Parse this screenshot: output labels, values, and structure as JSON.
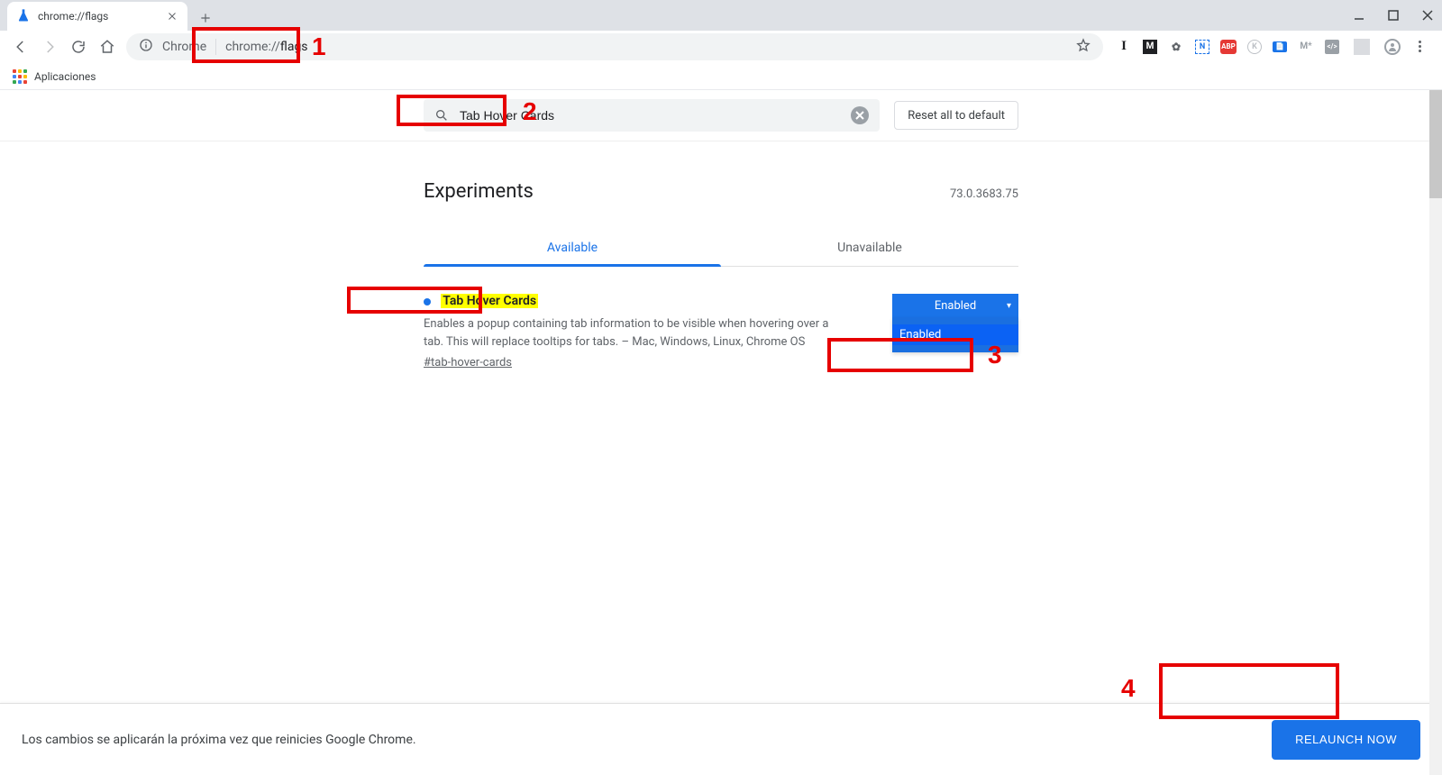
{
  "browser": {
    "tab_title": "chrome://flags",
    "omnibox_prefix": "Chrome",
    "omnibox_url_scheme": "chrome://",
    "omnibox_url_path": "flags",
    "bookmarks_label": "Aplicaciones"
  },
  "flags_page": {
    "search_value": "Tab Hover Cards",
    "reset_label": "Reset all to default",
    "heading": "Experiments",
    "version": "73.0.3683.75",
    "tab_available": "Available",
    "tab_unavailable": "Unavailable",
    "flag_title": "Tab Hover Cards",
    "flag_description": "Enables a popup containing tab information to be visible when hovering over a tab. This will replace tooltips for tabs. – Mac, Windows, Linux, Chrome OS",
    "flag_anchor": "#tab-hover-cards",
    "select_current": "Enabled",
    "dropdown_selected": "Enabled"
  },
  "relaunch": {
    "message": "Los cambios se aplicarán la próxima vez que reinicies Google Chrome.",
    "button": "RELAUNCH NOW"
  },
  "annotations": {
    "a1": "1",
    "a2": "2",
    "a3": "3",
    "a4": "4"
  }
}
